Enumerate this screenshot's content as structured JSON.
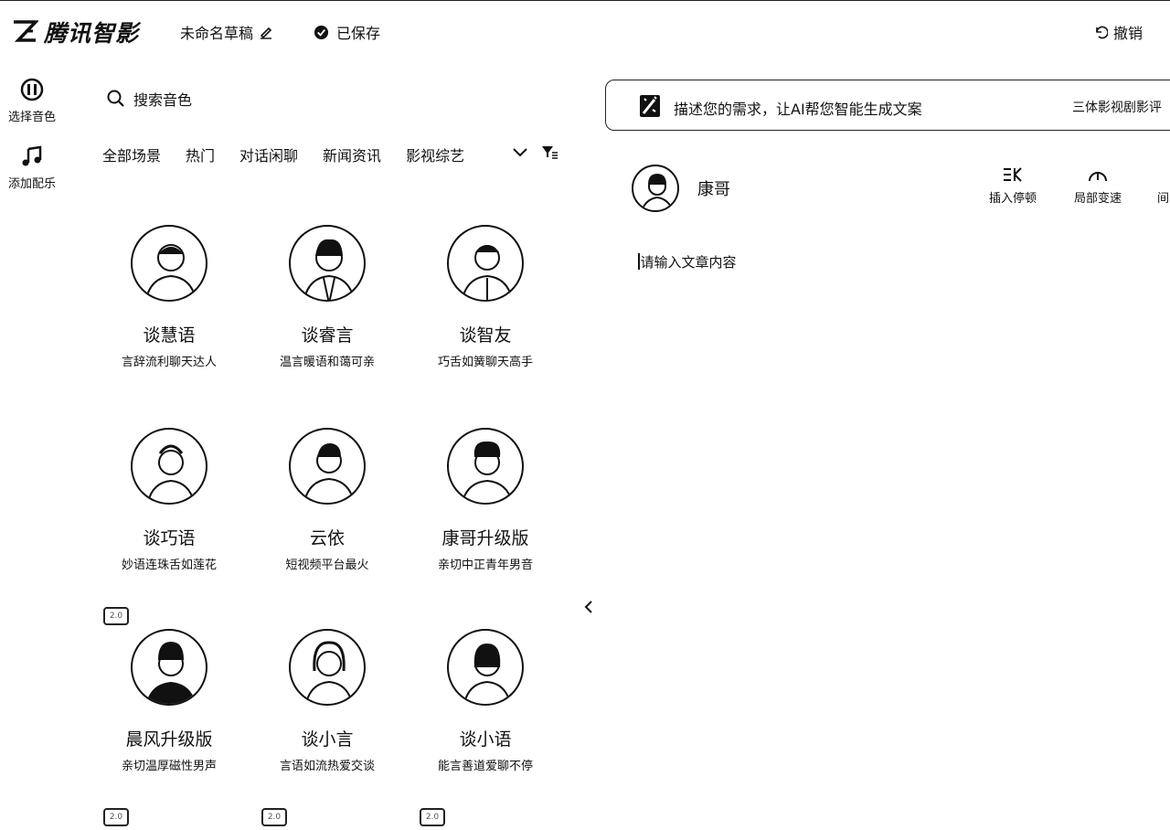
{
  "header": {
    "brand": "腾讯智影",
    "draft_title": "未命名草稿",
    "save_status": "已保存",
    "undo_label": "撤销"
  },
  "leftnav": {
    "items": [
      {
        "label": "选择音色",
        "icon": "voice-icon"
      },
      {
        "label": "添加配乐",
        "icon": "music-note-icon"
      }
    ]
  },
  "voice_panel": {
    "search_placeholder": "搜索音色",
    "categories": [
      "全部场景",
      "热门",
      "对话闲聊",
      "新闻资讯",
      "影视综艺"
    ],
    "voices": [
      {
        "name": "谈慧语",
        "desc": "言辞流利聊天达人"
      },
      {
        "name": "谈睿言",
        "desc": "温言暖语和蔼可亲"
      },
      {
        "name": "谈智友",
        "desc": "巧舌如簧聊天高手"
      },
      {
        "name": "谈巧语",
        "desc": "妙语连珠舌如莲花"
      },
      {
        "name": "云依",
        "desc": "短视频平台最火"
      },
      {
        "name": "康哥升级版",
        "desc": "亲切中正青年男音"
      },
      {
        "name": "晨风升级版",
        "desc": "亲切温厚磁性男声"
      },
      {
        "name": "谈小言",
        "desc": "言语如流热爱交谈"
      },
      {
        "name": "谈小语",
        "desc": "能言善道爱聊不停"
      }
    ]
  },
  "editor_panel": {
    "ai_prompt": "描述您的需求，让AI帮您智能生成文案",
    "ai_sample": "三体影视剧影评",
    "speaker_name": "康哥",
    "tools": [
      "插入停顿",
      "局部变速",
      "间"
    ],
    "content_placeholder": "请输入文章内容"
  }
}
